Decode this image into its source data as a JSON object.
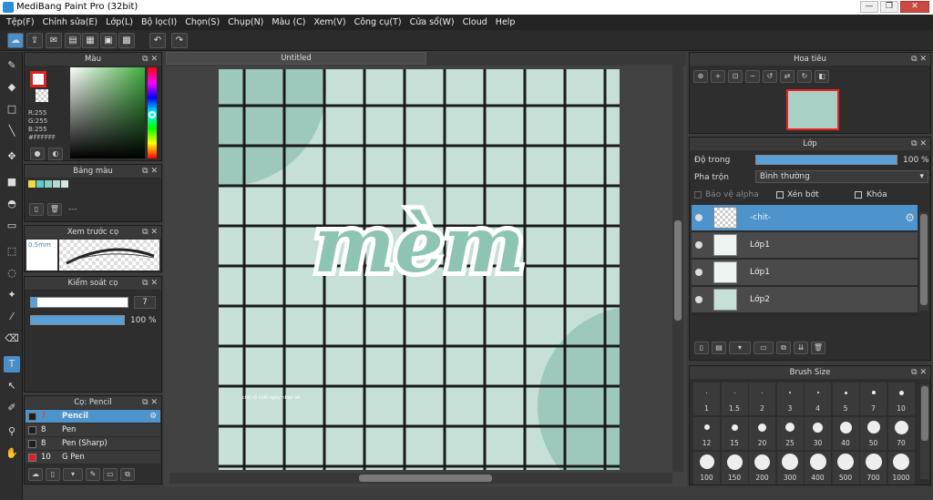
{
  "window": {
    "title": "MediBang Paint Pro (32bit)",
    "min": "—",
    "max": "❐",
    "close": "✕"
  },
  "menu": [
    "Tệp(F)",
    "Chỉnh sửa(E)",
    "Lớp(L)",
    "Bộ lọc(I)",
    "Chọn(S)",
    "Chụp(N)",
    "Màu (C)",
    "Xem(V)",
    "Công cụ(T)",
    "Cửa sổ(W)",
    "Cloud",
    "Help"
  ],
  "toolbar": {
    "icons": [
      "cloud-icon",
      "share-icon",
      "comment-icon",
      "page-icon",
      "page-setting-icon",
      "comic-icon",
      "grid-icon",
      "undo-icon",
      "redo-icon"
    ]
  },
  "color_panel": {
    "title": "Màu",
    "r": "R:255",
    "g": "G:255",
    "b": "B:255",
    "hex": "#FFFFFF"
  },
  "palette_panel": {
    "title": "Bảng màu",
    "empty_label": "---",
    "colors": [
      "#f0d84a",
      "#5fc8c8",
      "#8ad0c8",
      "#b8d8d0",
      "#d8e4e0"
    ]
  },
  "brush_preview": {
    "title": "Xem trước cọ",
    "size_label": "0.5mm"
  },
  "brush_control": {
    "title": "Kiểm soát cọ",
    "size_value": "7",
    "opacity_value": "100 %",
    "size_fill": 0.07,
    "opacity_fill": 1.0
  },
  "brush_list": {
    "title": "Cọ: Pencil",
    "items": [
      {
        "num": "7",
        "name": "Pencil",
        "color": "#1e1e1e",
        "selected": true
      },
      {
        "num": "8",
        "name": "Pen",
        "color": "#1e1e1e",
        "selected": false
      },
      {
        "num": "8",
        "name": "Pen (Sharp)",
        "color": "#1e1e1e",
        "selected": false
      },
      {
        "num": "10",
        "name": "G Pen",
        "color": "#e02020",
        "selected": false
      }
    ]
  },
  "canvas": {
    "tab_title": "Untitled",
    "art_text": "mèm",
    "art_small_text": "chit\nrồ cuối ngày\nnhạc về"
  },
  "navigator": {
    "title": "Hoa tiêu"
  },
  "layers": {
    "title": "Lớp",
    "opacity_label": "Độ trong",
    "opacity_value": "100 %",
    "opacity": 1.0,
    "blend_label": "Pha trộn",
    "blend_value": "Bình thường",
    "protect_alpha": "Bảo vệ alpha",
    "clipping": "Xén bớt",
    "lock": "Khóa",
    "items": [
      {
        "name": "-chit-",
        "selected": true
      },
      {
        "name": "Lớp1",
        "selected": false
      },
      {
        "name": "Lớp1",
        "selected": false
      },
      {
        "name": "Lớp2",
        "selected": false
      }
    ]
  },
  "brush_size": {
    "title": "Brush Size",
    "row1": [
      "1",
      "1.5",
      "2",
      "3",
      "4",
      "5",
      "7",
      "10"
    ],
    "row2": [
      "12",
      "15",
      "20",
      "25",
      "30",
      "40",
      "50",
      "70"
    ],
    "row3": [
      "100",
      "150",
      "200",
      "300",
      "400",
      "500",
      "700",
      "1000"
    ]
  }
}
